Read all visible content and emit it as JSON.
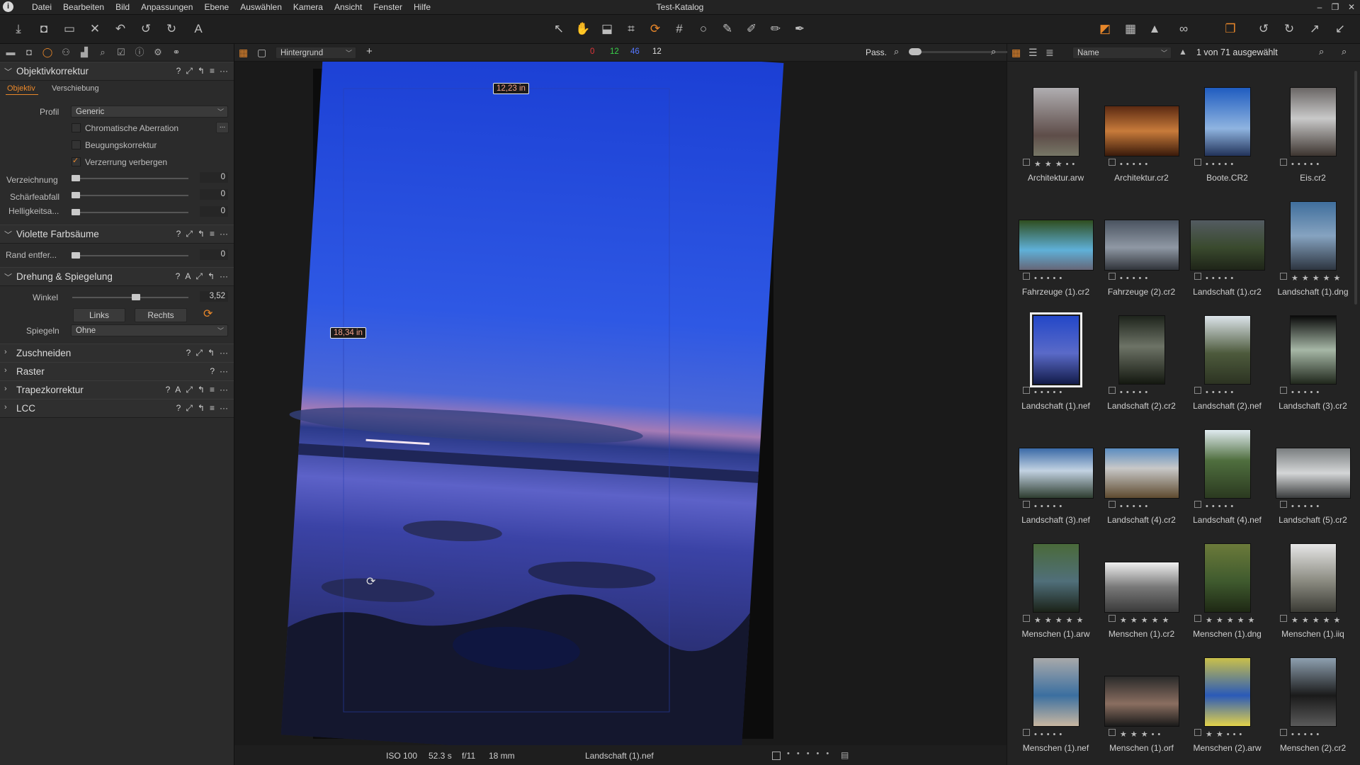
{
  "menubar": {
    "app_icon": "i",
    "items": [
      "Datei",
      "Bearbeiten",
      "Bild",
      "Anpassungen",
      "Ebene",
      "Auswählen",
      "Kamera",
      "Ansicht",
      "Fenster",
      "Hilfe"
    ],
    "title": "Test-Katalog",
    "win_min": "–",
    "win_max": "❐",
    "win_close": "✕"
  },
  "left_panel": {
    "lens_section": {
      "title": "Objektivkorrektur",
      "tab_active": "Objektiv",
      "tab_other": "Verschiebung",
      "profile_label": "Profil",
      "profile_value": "Generic",
      "chromatic_label": "Chromatische Aberration",
      "chromatic_more": "...",
      "diffraction_label": "Beugungskorrektur",
      "hide_distortion_label": "Verzerrung verbergen",
      "distortion_label": "Verzeichnung",
      "distortion_value": "0",
      "sharpness_label": "Schärfeabfall",
      "sharpness_value": "0",
      "brightness_label": "Helligkeitsa...",
      "brightness_value": "0"
    },
    "fringe_section": {
      "title": "Violette Farbsäume",
      "edge_label": "Rand entfer...",
      "edge_value": "0"
    },
    "rotation_section": {
      "title": "Drehung & Spiegelung",
      "angle_label": "Winkel",
      "angle_value": "3,52",
      "angle_level": 0.55,
      "left_button": "Links",
      "right_button": "Rechts",
      "mirror_label": "Spiegeln",
      "mirror_value": "Ohne"
    },
    "collapsed_sections": [
      "Zuschneiden",
      "Raster",
      "Trapezkorrektur",
      "LCC"
    ]
  },
  "viewer_bar": {
    "background_select": "Hintergrund",
    "count_red": "0",
    "count_green": "12",
    "count_blue": "46",
    "count_white": "12",
    "zoom_label": "Pass.",
    "colors": {
      "red": "#e0343a",
      "green": "#39d04a",
      "blue": "#5577ff"
    }
  },
  "viewer": {
    "measure_width": "12,23 in",
    "measure_height": "18,34 in"
  },
  "viewer_status": {
    "iso": "ISO 100",
    "shutter": "52.3 s",
    "aperture": "f/11",
    "focal": "18 mm",
    "filename": "Landschaft (1).nef"
  },
  "browser_bar": {
    "sort_value": "Name",
    "selection_text": "1 von 71 ausgewählt"
  },
  "thumbnails": [
    {
      "name": "Architektur.arw",
      "rating": 3
    },
    {
      "name": "Architektur.cr2",
      "rating": 0
    },
    {
      "name": "Boote.CR2",
      "rating": 0
    },
    {
      "name": "Eis.cr2",
      "rating": 0
    },
    {
      "name": "Fahrzeuge (1).cr2",
      "rating": 0
    },
    {
      "name": "Fahrzeuge (2).cr2",
      "rating": 0
    },
    {
      "name": "Landschaft (1).cr2",
      "rating": 0
    },
    {
      "name": "Landschaft (1).dng",
      "rating": 5
    },
    {
      "name": "Landschaft (1).nef",
      "rating": 0,
      "selected": true
    },
    {
      "name": "Landschaft (2).cr2",
      "rating": 0
    },
    {
      "name": "Landschaft (2).nef",
      "rating": 0
    },
    {
      "name": "Landschaft (3).cr2",
      "rating": 0
    },
    {
      "name": "Landschaft (3).nef",
      "rating": 0
    },
    {
      "name": "Landschaft (4).cr2",
      "rating": 0
    },
    {
      "name": "Landschaft (4).nef",
      "rating": 0
    },
    {
      "name": "Landschaft (5).cr2",
      "rating": 0
    },
    {
      "name": "Menschen (1).arw",
      "rating": 5
    },
    {
      "name": "Menschen (1).cr2",
      "rating": 5
    },
    {
      "name": "Menschen (1).dng",
      "rating": 5
    },
    {
      "name": "Menschen (1).iiq",
      "rating": 5
    },
    {
      "name": "Menschen (1).nef",
      "rating": 0
    },
    {
      "name": "Menschen (1).orf",
      "rating": 3
    },
    {
      "name": "Menschen (2).arw",
      "rating": 2
    },
    {
      "name": "Menschen (2).cr2",
      "rating": 0
    }
  ]
}
